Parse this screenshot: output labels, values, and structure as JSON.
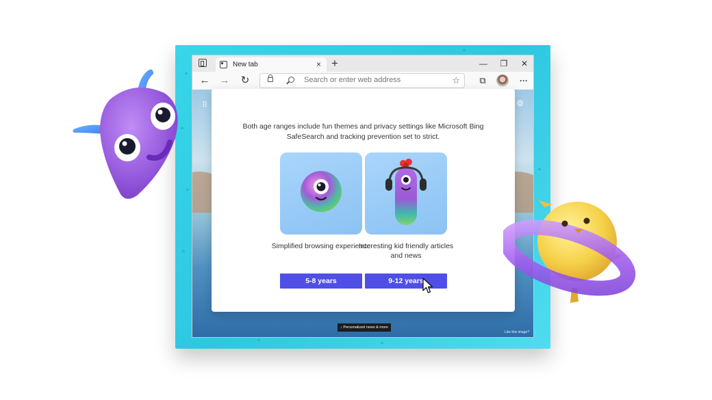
{
  "browser": {
    "tab": {
      "title": "New tab",
      "close_glyph": "×"
    },
    "new_tab_glyph": "+",
    "window_controls": {
      "minimize": "—",
      "maximize": "❐",
      "close": "✕"
    },
    "nav": {
      "back": "←",
      "forward": "→",
      "refresh": "↻"
    },
    "address_bar": {
      "placeholder": "Search or enter web address",
      "favorite_glyph": "☆"
    },
    "toolbar_right": {
      "collections": "⧉",
      "more": "···"
    }
  },
  "new_tab_page": {
    "apps_glyph": "⠿",
    "settings_glyph": "⚙",
    "news_pill": "↓  Personalized news & more",
    "like_image": "Like this image?"
  },
  "modal": {
    "description": "Both age ranges include fun themes and privacy settings like Microsoft Bing SafeSearch and tracking prevention set to strict.",
    "options": [
      {
        "caption": "Simplified browsing experience",
        "button": "5-8 years"
      },
      {
        "caption": "Interesting kid friendly articles and news",
        "button": "9-12 years"
      }
    ]
  },
  "colors": {
    "frame": "#2ec7e0",
    "button": "#4f4fe8",
    "card": "#9ccdf8",
    "mascot_purple": "#a46be6",
    "mascot_yellow": "#f5d64a"
  }
}
